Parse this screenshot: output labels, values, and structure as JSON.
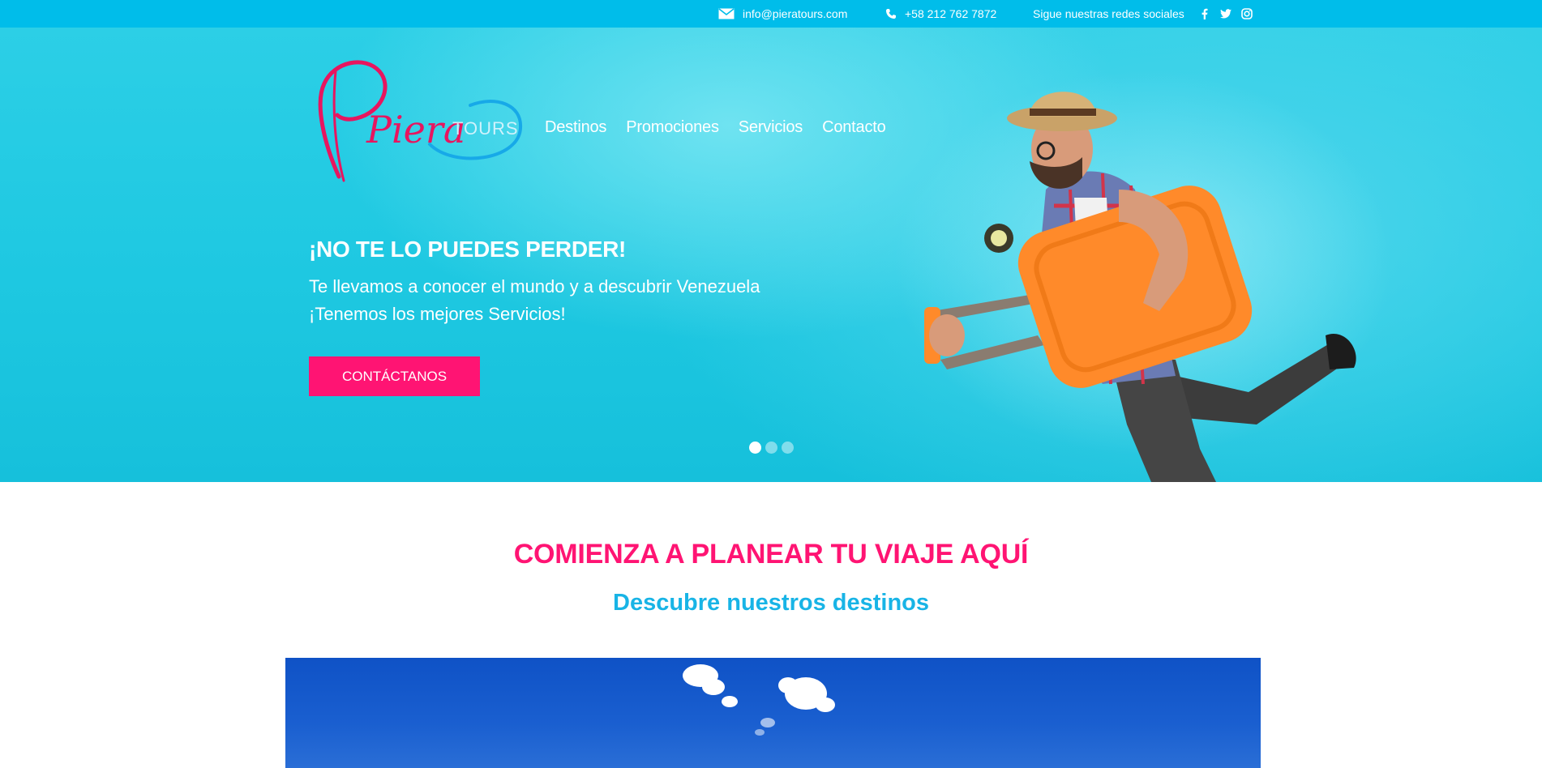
{
  "topbar": {
    "email": "info@pieratours.com",
    "phone": "+58 212 762 7872",
    "social_label": "Sigue nuestras redes sociales",
    "icons": [
      "envelope-icon",
      "phone-icon",
      "facebook-icon",
      "twitter-icon",
      "instagram-icon"
    ]
  },
  "logo": {
    "script_text": "Piera",
    "suffix_text": "TOURS"
  },
  "nav": {
    "items": [
      {
        "label": "Destinos"
      },
      {
        "label": "Promociones"
      },
      {
        "label": "Servicios"
      },
      {
        "label": "Contacto"
      }
    ]
  },
  "hero": {
    "title": "¡NO TE LO PUEDES PERDER!",
    "subtitle_line1": "Te llevamos a conocer el mundo y a descubrir Venezuela",
    "subtitle_line2": "¡Tenemos los mejores Servicios!",
    "cta_label": "CONTÁCTANOS",
    "slides_count": 3,
    "active_slide": 1
  },
  "section": {
    "title": "COMIENZA A PLANEAR TU VIAJE AQUÍ",
    "subtitle": "Descubre nuestros destinos"
  },
  "colors": {
    "topbar": "#00bdea",
    "hero_bg": "#1ec8e1",
    "accent_pink": "#ff1473",
    "accent_blue": "#18b4e6",
    "white": "#ffffff"
  }
}
